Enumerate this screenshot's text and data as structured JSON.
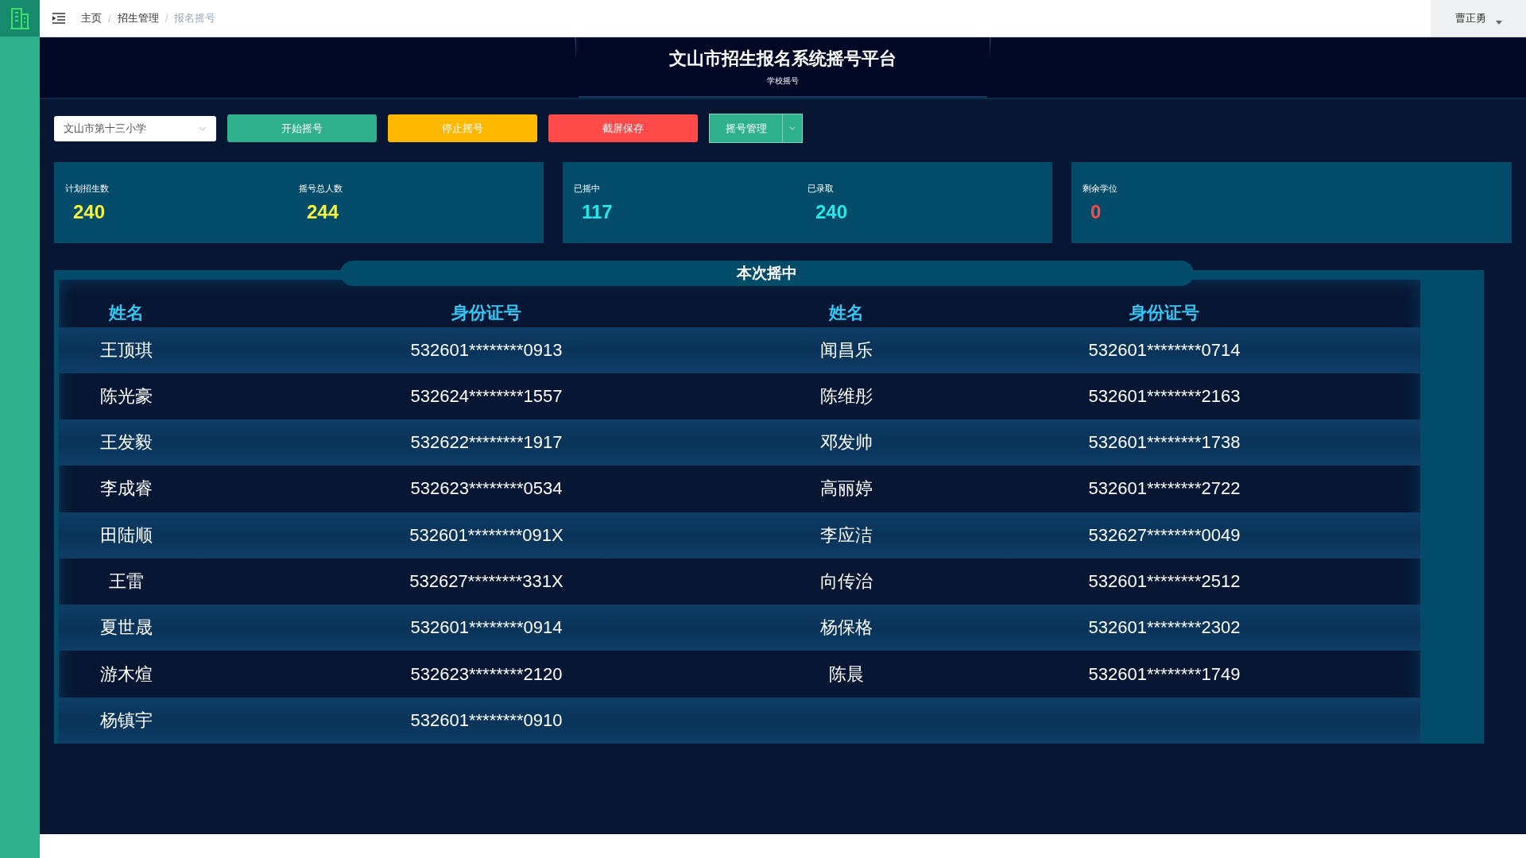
{
  "breadcrumb": [
    {
      "label": "主页",
      "selected": false
    },
    {
      "label": "招生管理",
      "selected": false
    },
    {
      "label": "报名摇号",
      "selected": true
    }
  ],
  "breadcrumb_separator": "/",
  "user": "曹正勇",
  "header": {
    "title": "文山市招生报名系统摇号平台",
    "subtitle": "学校摇号"
  },
  "school_select": {
    "value": "文山市第十三小学"
  },
  "buttons": [
    {
      "label": "开始摇号",
      "kind": "primary"
    },
    {
      "label": "停止摇号",
      "kind": "warning"
    },
    {
      "label": "截屏保存",
      "kind": "danger"
    }
  ],
  "split_button": {
    "label": "摇号管理"
  },
  "stat_cards": [
    {
      "items": [
        {
          "label": "计划招生数",
          "value": "240",
          "color": "#f7f13a"
        },
        {
          "label": "摇号总人数",
          "value": "244",
          "color": "#f7f13a"
        }
      ]
    },
    {
      "items": [
        {
          "label": "已摇中",
          "value": "117",
          "color": "#25e8e8"
        },
        {
          "label": "已录取",
          "value": "240",
          "color": "#25e8e8"
        }
      ]
    },
    {
      "items": [
        {
          "label": "剩余学位",
          "value": "0",
          "color": "#ff4a4a"
        }
      ]
    }
  ],
  "results": {
    "title": "本次摇中",
    "columns": [
      "姓名",
      "身份证号",
      "姓名",
      "身份证号"
    ],
    "rows": [
      [
        "王顶琪",
        "532601********0913",
        "闻昌乐",
        "532601********0714"
      ],
      [
        "陈光豪",
        "532624********1557",
        "陈维彤",
        "532601********2163"
      ],
      [
        "王发毅",
        "532622********1917",
        "邓发帅",
        "532601********1738"
      ],
      [
        "李成睿",
        "532623********0534",
        "高丽婷",
        "532601********2722"
      ],
      [
        "田陆顺",
        "532601********091X",
        "李应洁",
        "532627********0049"
      ],
      [
        "王雷",
        "532627********331X",
        "向传治",
        "532601********2512"
      ],
      [
        "夏世晟",
        "532601********0914",
        "杨保格",
        "532601********2302"
      ],
      [
        "游木煊",
        "532623********2120",
        "陈晨",
        "532601********1749"
      ],
      [
        "杨镇宇",
        "532601********0910"
      ]
    ]
  }
}
